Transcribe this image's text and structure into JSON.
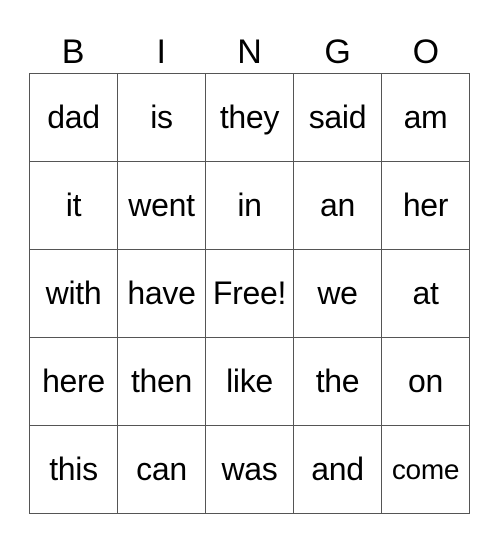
{
  "header": [
    "B",
    "I",
    "N",
    "G",
    "O"
  ],
  "rows": [
    [
      "dad",
      "is",
      "they",
      "said",
      "am"
    ],
    [
      "it",
      "went",
      "in",
      "an",
      "her"
    ],
    [
      "with",
      "have",
      "Free!",
      "we",
      "at"
    ],
    [
      "here",
      "then",
      "like",
      "the",
      "on"
    ],
    [
      "this",
      "can",
      "was",
      "and",
      "come"
    ]
  ]
}
